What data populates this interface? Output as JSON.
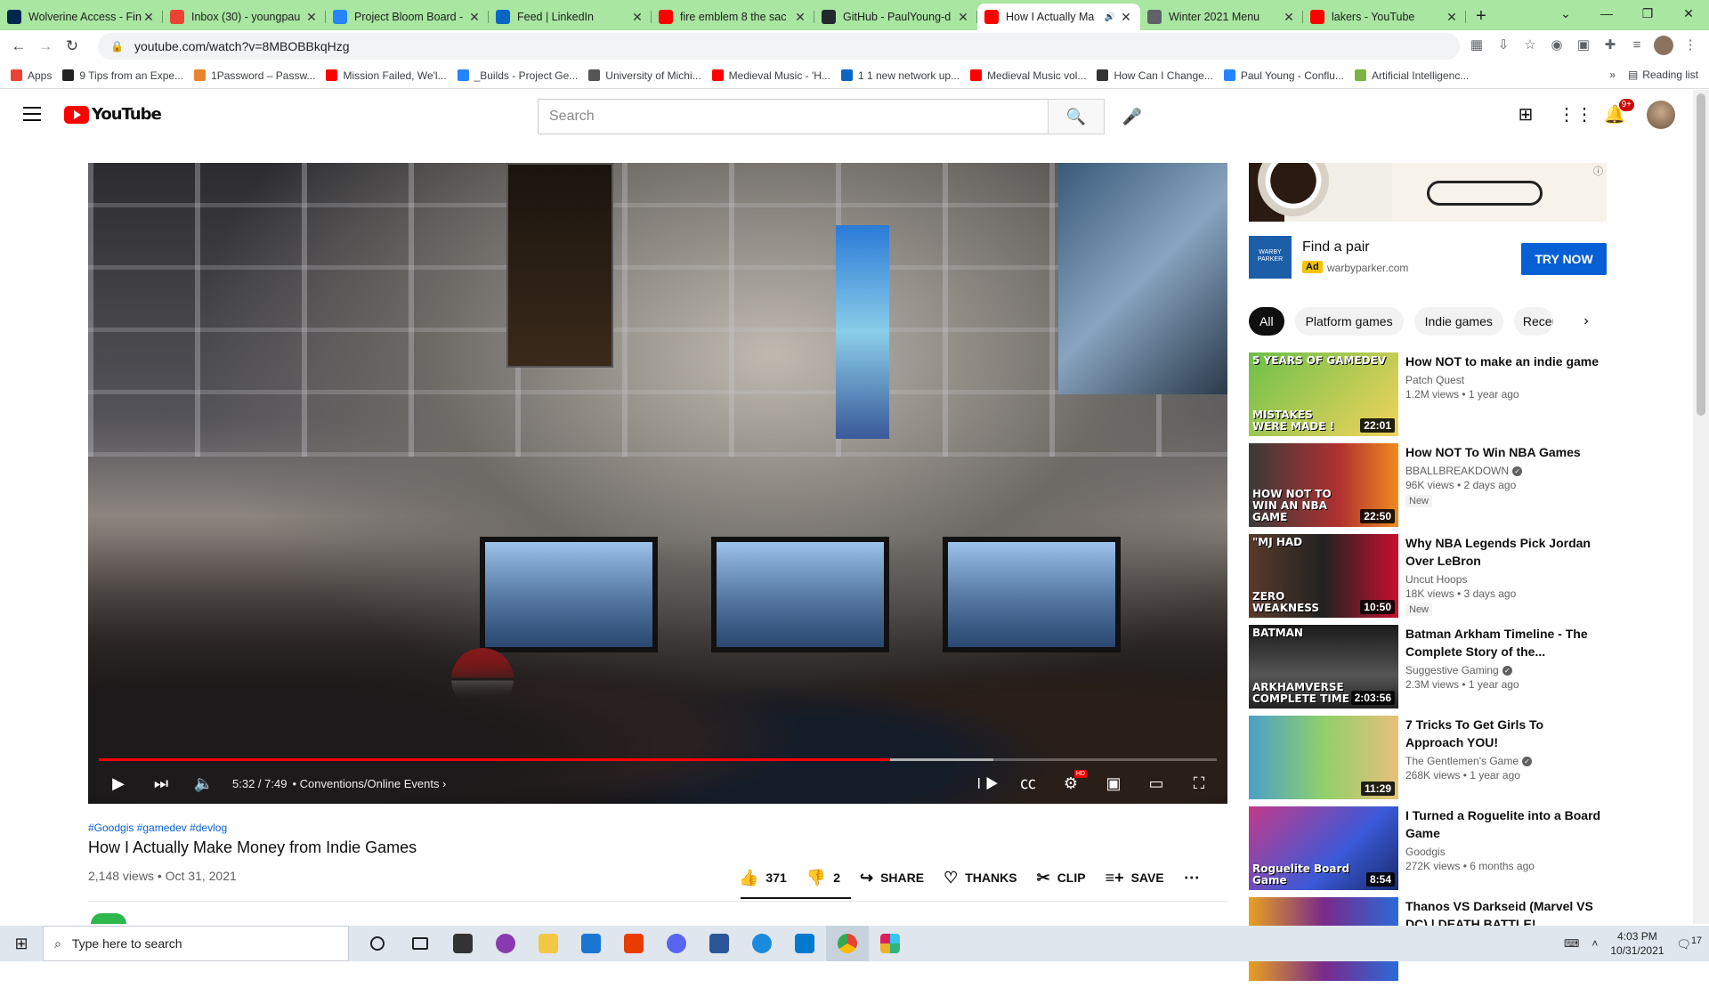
{
  "browser": {
    "tabs": [
      {
        "title": "Wolverine Access - Fin",
        "favicon_color": "#00274c"
      },
      {
        "title": "Inbox (30) - youngpau",
        "favicon_color": "#ea4335"
      },
      {
        "title": "Project Bloom Board -",
        "favicon_color": "#2684ff"
      },
      {
        "title": "Feed | LinkedIn",
        "favicon_color": "#0a66c2"
      },
      {
        "title": "fire emblem 8 the sac",
        "favicon_color": "#ff0000"
      },
      {
        "title": "GitHub - PaulYoung-d",
        "favicon_color": "#24292e"
      },
      {
        "title": "How I Actually Ma",
        "favicon_color": "#ff0000",
        "active": true
      },
      {
        "title": "Winter 2021 Menu",
        "favicon_color": "#5f6368"
      },
      {
        "title": "lakers - YouTube",
        "favicon_color": "#ff0000"
      }
    ],
    "url": "youtube.com/watch?v=8MBOBBkqHzg",
    "bookmarks": [
      {
        "label": "Apps",
        "color": "#ea4335"
      },
      {
        "label": "9 Tips from an Expe...",
        "color": "#222"
      },
      {
        "label": "1Password – Passw...",
        "color": "#e8852e"
      },
      {
        "label": "Mission Failed, We'l...",
        "color": "#ff0000"
      },
      {
        "label": "_Builds - Project Ge...",
        "color": "#2684ff"
      },
      {
        "label": "University of Michi...",
        "color": "#555"
      },
      {
        "label": "Medieval Music - 'H...",
        "color": "#ff0000"
      },
      {
        "label": "1 1 new network up...",
        "color": "#0a66c2"
      },
      {
        "label": "Medieval Music vol...",
        "color": "#ff0000"
      },
      {
        "label": "How Can I Change...",
        "color": "#333"
      },
      {
        "label": "Paul Young - Conflu...",
        "color": "#2684ff"
      },
      {
        "label": "Artificial Intelligenc...",
        "color": "#7cb342"
      }
    ],
    "reading_list": "Reading list",
    "more_bookmarks": "»"
  },
  "youtube": {
    "logo_text": "YouTube",
    "search_placeholder": "Search",
    "notifications_badge": "9+",
    "player": {
      "current_time": "5:32",
      "duration": "7:49",
      "time_display": "5:32 / 7:49",
      "chapter": "Conventions/Online Events",
      "played_fraction": 0.708,
      "buffered_fraction": 0.8,
      "hd_badge": "HD"
    },
    "video": {
      "hashtags": "#Goodgis #gamedev #devlog",
      "title": "How I Actually Make Money from Indie Games",
      "meta": "2,148 views • Oct 31, 2021",
      "actions": {
        "likes": "371",
        "dislikes": "2",
        "share": "SHARE",
        "thanks": "THANKS",
        "clip": "CLIP",
        "save": "SAVE"
      }
    },
    "ad": {
      "logo_text": "WARBY PARKER",
      "title": "Find a pair",
      "badge": "Ad",
      "domain": "warbyparker.com",
      "cta": "TRY NOW"
    },
    "chips": [
      "All",
      "Platform games",
      "Indie games",
      "Recen"
    ],
    "recommendations": [
      {
        "title": "How NOT to make an indie game",
        "channel": "Patch Quest",
        "verified": false,
        "stats": "1.2M views • 1 year ago",
        "duration": "22:01",
        "new": false,
        "thumb_top": "5 YEARS OF GAMEDEV",
        "thumb_bottom": "MISTAKES WERE MADE !",
        "bg": "linear-gradient(135deg,#6cc04a,#f3d35c)"
      },
      {
        "title": "How NOT To Win NBA Games",
        "channel": "BBALLBREAKDOWN",
        "verified": true,
        "stats": "96K views • 2 days ago",
        "duration": "22:50",
        "new": true,
        "new_label": "New",
        "thumb_top": "",
        "thumb_bottom": "HOW NOT TO WIN AN NBA GAME",
        "bg": "linear-gradient(90deg,#3a3a3a,#b03030 60%,#f08a20)"
      },
      {
        "title": "Why NBA Legends Pick Jordan Over LeBron",
        "channel": "Uncut Hoops",
        "verified": false,
        "stats": "18K views • 3 days ago",
        "duration": "10:50",
        "new": true,
        "new_label": "New",
        "thumb_top": "\"MJ HAD",
        "thumb_bottom": "ZERO WEAKNESS",
        "bg": "linear-gradient(90deg,#5a3a2a,#222 50%,#c8102e)"
      },
      {
        "title": "Batman Arkham Timeline - The Complete Story of the...",
        "channel": "Suggestive Gaming",
        "verified": true,
        "stats": "2.3M views • 1 year ago",
        "duration": "2:03:56",
        "new": false,
        "thumb_top": "BATMAN",
        "thumb_bottom": "ARKHAMVERSE COMPLETE TIME",
        "bg": "linear-gradient(180deg,#1a1a1a,#555 60%,#222)"
      },
      {
        "title": "7 Tricks To Get Girls To Approach YOU!",
        "channel": "The Gentlemen's Game",
        "verified": true,
        "stats": "268K views • 1 year ago",
        "duration": "11:29",
        "new": false,
        "thumb_top": "",
        "thumb_bottom": "",
        "bg": "linear-gradient(90deg,#4aa0c8,#8fd06a 50%,#e8c07a)"
      },
      {
        "title": "I Turned a Roguelite into a Board Game",
        "channel": "Goodgis",
        "verified": false,
        "stats": "272K views • 6 months ago",
        "duration": "8:54",
        "new": false,
        "thumb_top": "",
        "thumb_bottom": "Roguelite Board Game",
        "bg": "linear-gradient(135deg,#c23a8a,#3a5ad8 60%,#1a2a6a)"
      },
      {
        "title": "Thanos VS Darkseid (Marvel VS DC) | DEATH BATTLE!",
        "channel": "",
        "verified": false,
        "stats": "",
        "duration": "",
        "new": false,
        "thumb_top": "",
        "thumb_bottom": "",
        "bg": "linear-gradient(90deg,#e8a020,#7a2a8a 50%,#2a6ad8)"
      }
    ]
  },
  "taskbar": {
    "search_placeholder": "Type here to search",
    "time": "4:03 PM",
    "date": "10/31/2021",
    "notifications": "17"
  }
}
